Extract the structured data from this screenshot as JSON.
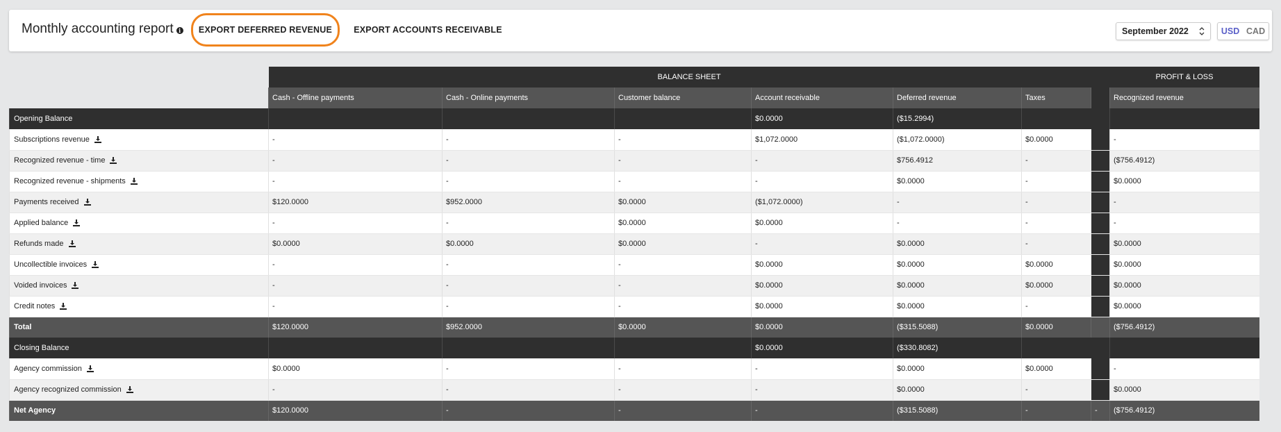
{
  "header": {
    "title": "Monthly accounting report",
    "export_deferred_label": "EXPORT DEFERRED REVENUE",
    "export_ar_label": "EXPORT ACCOUNTS RECEIVABLE",
    "month_value": "September 2022",
    "currency_usd": "USD",
    "currency_cad": "CAD"
  },
  "table": {
    "group_balance_sheet": "BALANCE SHEET",
    "group_profit_loss": "PROFIT & LOSS",
    "columns": {
      "c1": "Cash - Offline payments",
      "c2": "Cash - Online payments",
      "c3": "Customer balance",
      "c4": "Account receivable",
      "c5": "Deferred revenue",
      "c6": "Taxes",
      "c8": "Recognized revenue"
    },
    "rows": [
      {
        "label": "Opening Balance",
        "v": [
          "",
          "",
          "",
          "$0.0000",
          "($15.2994)",
          "",
          "",
          ""
        ]
      },
      {
        "label": "Subscriptions revenue",
        "v": [
          "-",
          "-",
          "-",
          "$1,072.0000",
          "($1,072.0000)",
          "$0.0000",
          "",
          "-"
        ]
      },
      {
        "label": "Recognized revenue - time",
        "v": [
          "-",
          "-",
          "-",
          "-",
          "$756.4912",
          "-",
          "",
          "($756.4912)"
        ]
      },
      {
        "label": "Recognized revenue - shipments",
        "v": [
          "-",
          "-",
          "-",
          "-",
          "$0.0000",
          "-",
          "",
          "$0.0000"
        ]
      },
      {
        "label": "Payments received",
        "v": [
          "$120.0000",
          "$952.0000",
          "$0.0000",
          "($1,072.0000)",
          "-",
          "-",
          "",
          "-"
        ]
      },
      {
        "label": "Applied balance",
        "v": [
          "-",
          "-",
          "$0.0000",
          "$0.0000",
          "-",
          "-",
          "",
          "-"
        ]
      },
      {
        "label": "Refunds made",
        "v": [
          "$0.0000",
          "$0.0000",
          "$0.0000",
          "-",
          "$0.0000",
          "-",
          "",
          "$0.0000"
        ]
      },
      {
        "label": "Uncollectible invoices",
        "v": [
          "-",
          "-",
          "-",
          "$0.0000",
          "$0.0000",
          "$0.0000",
          "",
          "$0.0000"
        ]
      },
      {
        "label": "Voided invoices",
        "v": [
          "-",
          "-",
          "-",
          "$0.0000",
          "$0.0000",
          "$0.0000",
          "",
          "$0.0000"
        ]
      },
      {
        "label": "Credit notes",
        "v": [
          "-",
          "-",
          "-",
          "$0.0000",
          "$0.0000",
          "-",
          "",
          "$0.0000"
        ]
      },
      {
        "label": "Total",
        "v": [
          "$120.0000",
          "$952.0000",
          "$0.0000",
          "$0.0000",
          "($315.5088)",
          "$0.0000",
          "",
          "($756.4912)"
        ]
      },
      {
        "label": "Closing Balance",
        "v": [
          "",
          "",
          "",
          "$0.0000",
          "($330.8082)",
          "",
          "",
          ""
        ]
      },
      {
        "label": "Agency commission",
        "v": [
          "$0.0000",
          "-",
          "-",
          "-",
          "$0.0000",
          "$0.0000",
          "",
          "-"
        ]
      },
      {
        "label": "Agency recognized commission",
        "v": [
          "-",
          "-",
          "-",
          "-",
          "$0.0000",
          "-",
          "",
          "$0.0000"
        ]
      },
      {
        "label": "Net Agency",
        "v": [
          "$120.0000",
          "-",
          "-",
          "-",
          "($315.5088)",
          "-",
          "-",
          "($756.4912)"
        ]
      }
    ]
  },
  "icons": {
    "download": "download-icon",
    "info": "info-icon",
    "chevron": "chevron-updown-icon"
  },
  "colors": {
    "accent_orange": "#f0831c",
    "usd_active": "#5a5fc8",
    "dark_row": "#2f2f2f",
    "total_row": "#555555"
  }
}
